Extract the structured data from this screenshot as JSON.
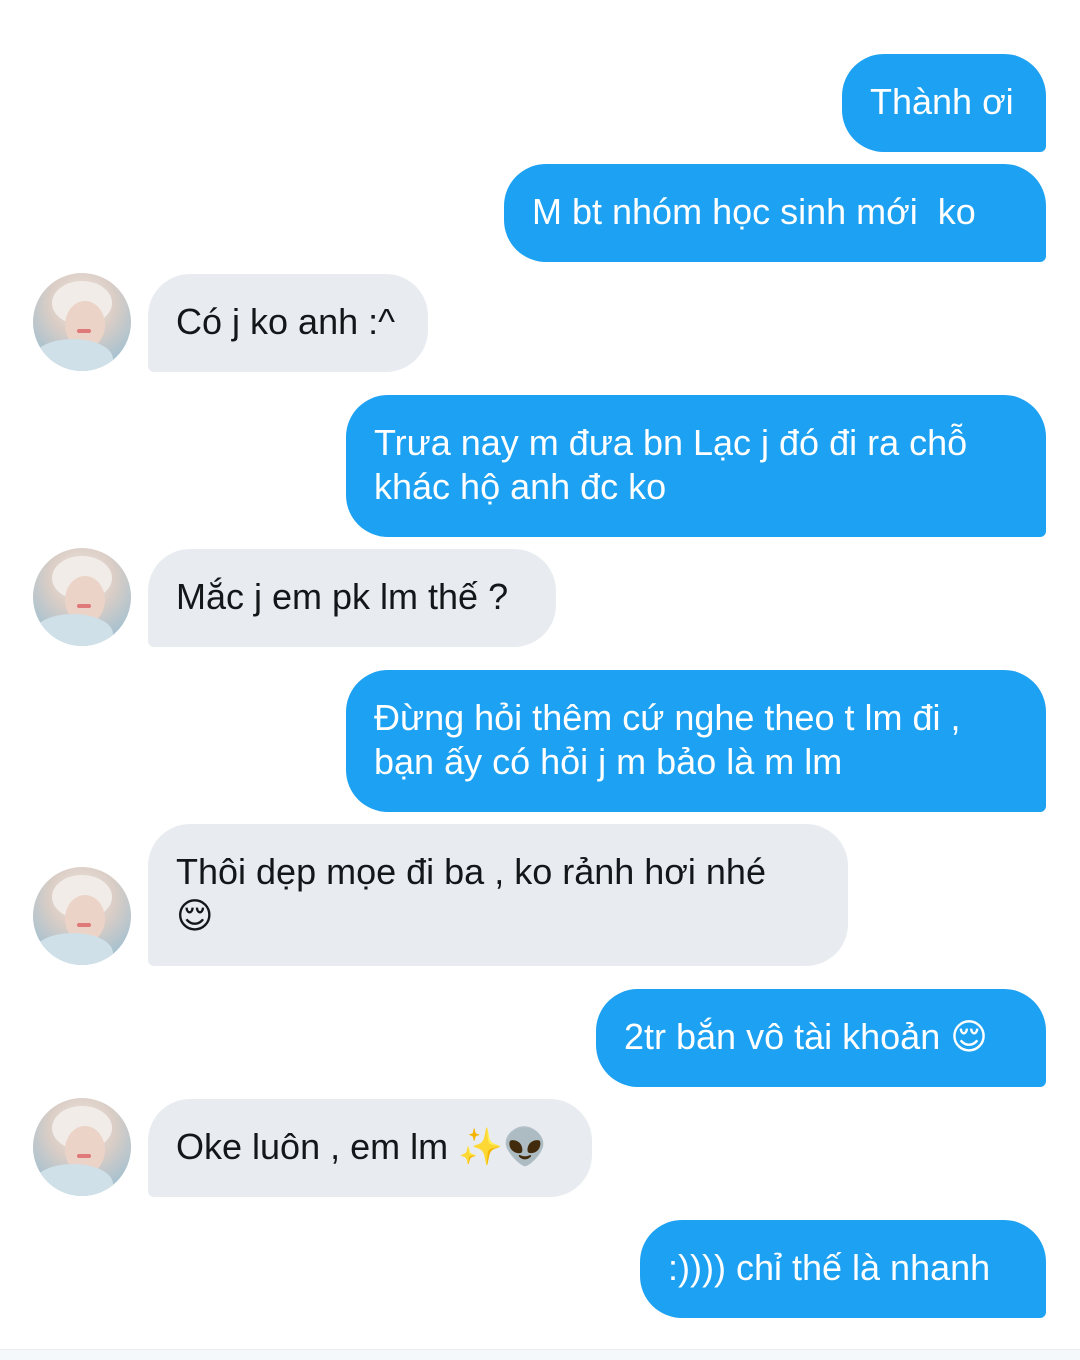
{
  "conversation": {
    "messages": [
      {
        "from": "me",
        "text": "Thành ơi"
      },
      {
        "from": "me",
        "text": "M bt nhóm học sinh mới  ko"
      },
      {
        "from": "them",
        "text": "Có j ko anh :^"
      },
      {
        "from": "me",
        "text": "Trưa nay m đưa bn Lạc j đó đi ra chỗ\nkhác hộ anh đc ko"
      },
      {
        "from": "them",
        "text": "Mắc j em pk lm thế ?"
      },
      {
        "from": "me",
        "text": "Đừng hỏi thêm cứ nghe theo t lm đi ,\nbạn ấy có hỏi j m bảo là m lm"
      },
      {
        "from": "them",
        "text": "Thôi dẹp mọe đi ba , ko rảnh hơi nhé\n😌"
      },
      {
        "from": "me",
        "text": "2tr bắn vô tài khoản 😌"
      },
      {
        "from": "them",
        "text": "Oke luôn , em lm ✨👽"
      },
      {
        "from": "me",
        "text": ":)))) chỉ thế là nhanh"
      }
    ]
  },
  "colors": {
    "sent_bubble": "#1da1f2",
    "received_bubble": "#e8ecf0",
    "sent_text": "#ffffff",
    "received_text": "#14171a"
  },
  "icons": {
    "avatar": "contact-avatar-photo"
  }
}
